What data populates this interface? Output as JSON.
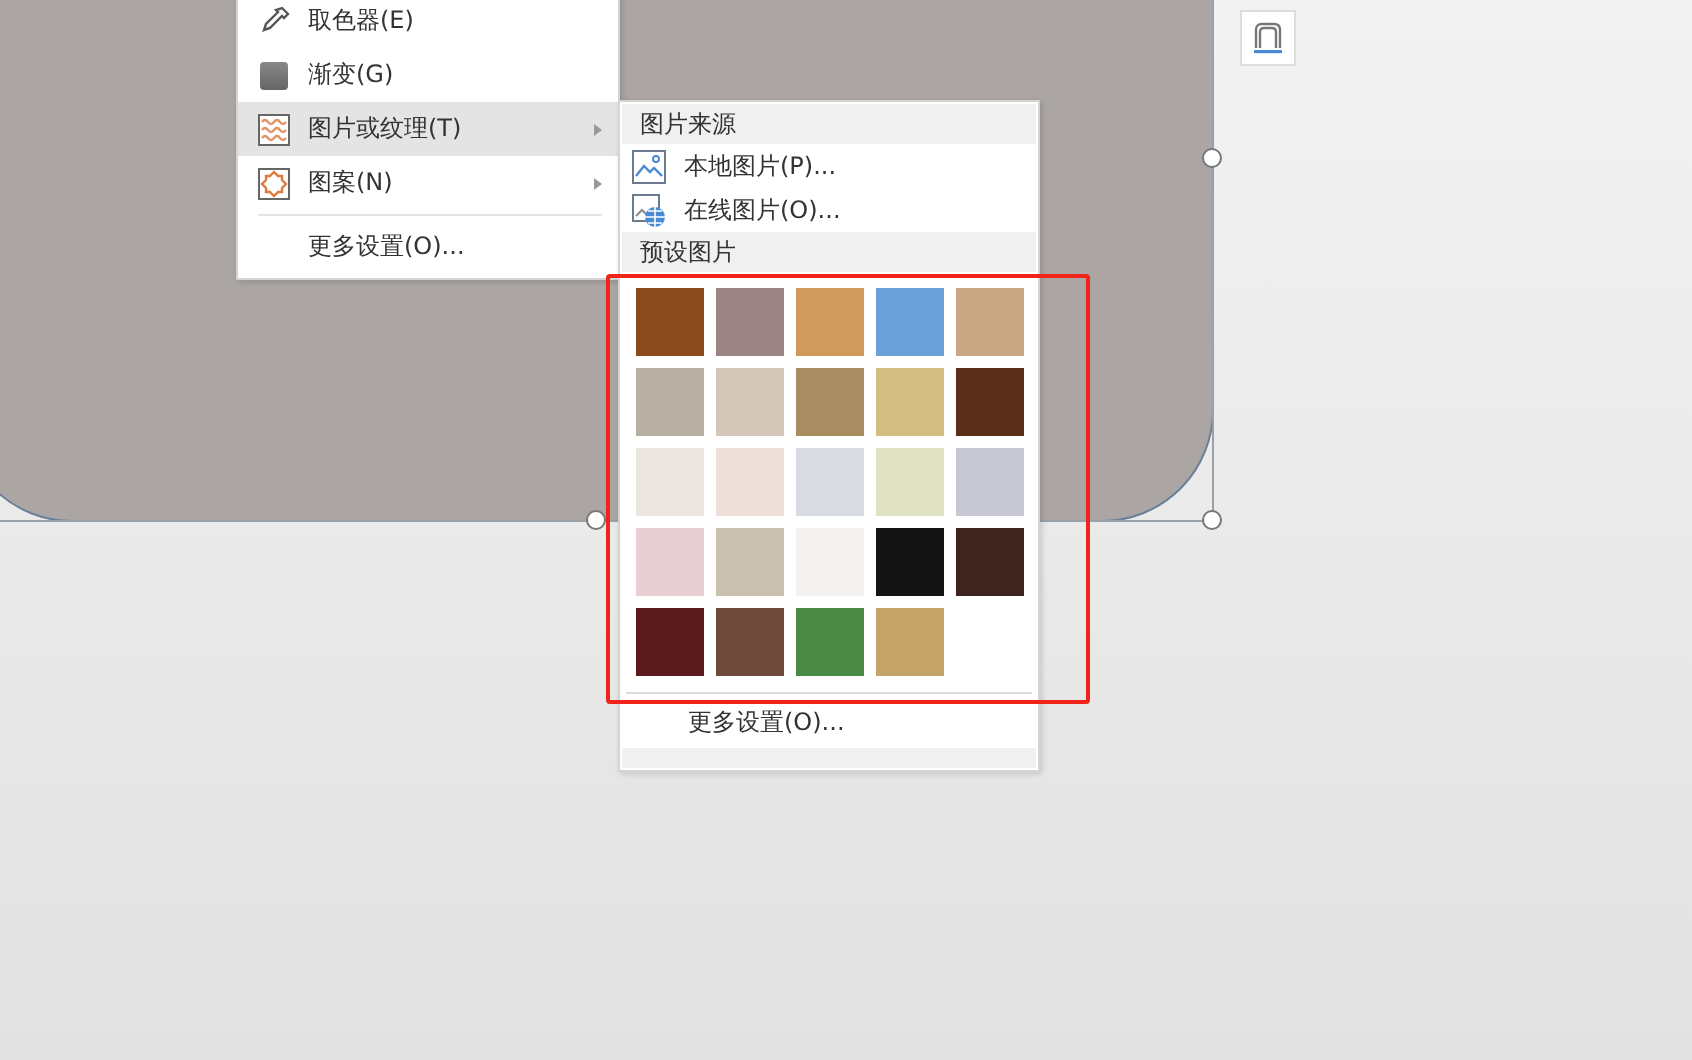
{
  "main_menu": {
    "items": [
      {
        "label": "取色器(E)",
        "selected": false,
        "has_submenu": false
      },
      {
        "label": "渐变(G)",
        "selected": false,
        "has_submenu": false
      },
      {
        "label": "图片或纹理(T)",
        "selected": true,
        "has_submenu": true
      },
      {
        "label": "图案(N)",
        "selected": false,
        "has_submenu": true
      }
    ],
    "more_settings": "更多设置(O)..."
  },
  "submenu": {
    "source_header": "图片来源",
    "source_items": [
      {
        "label": "本地图片(P)..."
      },
      {
        "label": "在线图片(O)..."
      }
    ],
    "preset_header": "预设图片",
    "textures": [
      {
        "color": "#8a4a1c"
      },
      {
        "color": "#9a8584"
      },
      {
        "color": "#d09a5c"
      },
      {
        "color": "#6a9fd8"
      },
      {
        "color": "#c9a684"
      },
      {
        "color": "#b9b0a4"
      },
      {
        "color": "#d4c6b8"
      },
      {
        "color": "#a88c62"
      },
      {
        "color": "#d4bd80"
      },
      {
        "color": "#5a2e18"
      },
      {
        "color": "#ebe6e0"
      },
      {
        "color": "#eee0d8"
      },
      {
        "color": "#d8dbe2"
      },
      {
        "color": "#dfe3c4"
      },
      {
        "color": "#c8c8d4"
      },
      {
        "color": "#e8cfd4"
      },
      {
        "color": "#cac0b0"
      },
      {
        "color": "#f4f2f0"
      },
      {
        "color": "#141414"
      },
      {
        "color": "#3e241e"
      },
      {
        "color": "#5a1a1e"
      },
      {
        "color": "#6e4a3c"
      },
      {
        "color": "#4a8a44"
      },
      {
        "color": "#c4a468"
      }
    ],
    "more_settings": "更多设置(O)..."
  }
}
